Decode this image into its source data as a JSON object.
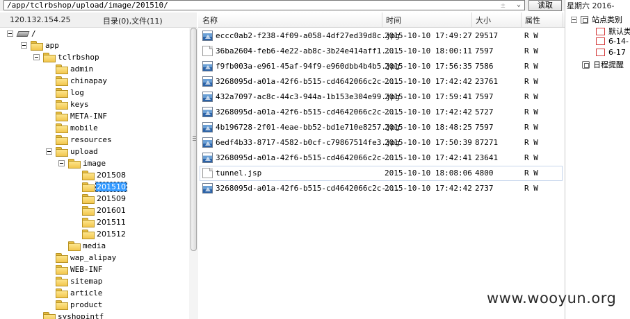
{
  "path_bar": {
    "path": "/app/tclrbshop/upload/image/201510/",
    "extra_glyph": "±",
    "dropdown_glyph": "⌄",
    "read_button": "读取"
  },
  "left_header": {
    "ip": "120.132.154.25",
    "counts": "目录(0),文件(11)"
  },
  "tree": [
    {
      "label": "/",
      "icon": "drive",
      "depth": 0,
      "expanded": true
    },
    {
      "label": "app",
      "icon": "folder",
      "depth": 1,
      "expanded": true
    },
    {
      "label": "tclrbshop",
      "icon": "folder",
      "depth": 2,
      "expanded": true
    },
    {
      "label": "admin",
      "icon": "folder",
      "depth": 3
    },
    {
      "label": "chinapay",
      "icon": "folder",
      "depth": 3
    },
    {
      "label": "log",
      "icon": "folder",
      "depth": 3
    },
    {
      "label": "keys",
      "icon": "folder",
      "depth": 3
    },
    {
      "label": "META-INF",
      "icon": "folder",
      "depth": 3
    },
    {
      "label": "mobile",
      "icon": "folder",
      "depth": 3
    },
    {
      "label": "resources",
      "icon": "folder",
      "depth": 3
    },
    {
      "label": "upload",
      "icon": "folder",
      "depth": 3,
      "expanded": true
    },
    {
      "label": "image",
      "icon": "folder",
      "depth": 4,
      "expanded": true
    },
    {
      "label": "201508",
      "icon": "folder",
      "depth": 5,
      "font": "sans"
    },
    {
      "label": "201510",
      "icon": "folder",
      "depth": 5,
      "selected": true,
      "font": "sans"
    },
    {
      "label": "201509",
      "icon": "folder",
      "depth": 5,
      "font": "sans"
    },
    {
      "label": "201601",
      "icon": "folder",
      "depth": 5,
      "font": "sans"
    },
    {
      "label": "201511",
      "icon": "folder",
      "depth": 5,
      "font": "sans"
    },
    {
      "label": "201512",
      "icon": "folder",
      "depth": 5,
      "font": "sans"
    },
    {
      "label": "media",
      "icon": "folder",
      "depth": 4
    },
    {
      "label": "wap_alipay",
      "icon": "folder",
      "depth": 3
    },
    {
      "label": "WEB-INF",
      "icon": "folder",
      "depth": 3
    },
    {
      "label": "sitemap",
      "icon": "folder",
      "depth": 3
    },
    {
      "label": "article",
      "icon": "folder",
      "depth": 3
    },
    {
      "label": "product",
      "icon": "folder",
      "depth": 3
    },
    {
      "label": "syshopintf",
      "icon": "folder",
      "depth": 2
    }
  ],
  "list_columns": {
    "name": "名称",
    "time": "时间",
    "size": "大小",
    "attr": "属性"
  },
  "files": [
    {
      "name": "eccc0ab2-f238-4f09-a058-4df27ed39d8c.jpg",
      "time": "2015-10-10 17:49:27",
      "size": "29517",
      "attr": "R W",
      "icon": "image"
    },
    {
      "name": "36ba2604-feb6-4e22-ab8c-3b24e414aff1....",
      "time": "2015-10-10 18:00:11",
      "size": "7597",
      "attr": "R W",
      "icon": "document"
    },
    {
      "name": "f9fb003a-e961-45af-94f9-e960dbb4b4b5.jpg",
      "time": "2015-10-10 17:56:35",
      "size": "7586",
      "attr": "R W",
      "icon": "image"
    },
    {
      "name": "3268095d-a01a-42f6-b515-cd4642066c2c-...",
      "time": "2015-10-10 17:42:42",
      "size": "23761",
      "attr": "R W",
      "icon": "image"
    },
    {
      "name": "432a7097-ac8c-44c3-944a-1b153e304e99.jpg",
      "time": "2015-10-10 17:59:41",
      "size": "7597",
      "attr": "R W",
      "icon": "image"
    },
    {
      "name": "3268095d-a01a-42f6-b515-cd4642066c2c-...",
      "time": "2015-10-10 17:42:42",
      "size": "5727",
      "attr": "R W",
      "icon": "image"
    },
    {
      "name": "4b196728-2f01-4eae-bb52-bd1e710e8257.jpg",
      "time": "2015-10-10 18:48:25",
      "size": "7597",
      "attr": "R W",
      "icon": "image"
    },
    {
      "name": "6edf4b33-8717-4582-b0cf-c79867514fe3.jpg",
      "time": "2015-10-10 17:50:39",
      "size": "87271",
      "attr": "R W",
      "icon": "image"
    },
    {
      "name": "3268095d-a01a-42f6-b515-cd4642066c2c-...",
      "time": "2015-10-10 17:42:41",
      "size": "23641",
      "attr": "R W",
      "icon": "image"
    },
    {
      "name": "tunnel.jsp",
      "time": "2015-10-10 18:08:06",
      "size": "4800",
      "attr": "R W",
      "icon": "document",
      "focused": true
    },
    {
      "name": "3268095d-a01a-42f6-b515-cd4642066c2c-...",
      "time": "2015-10-10 17:42:42",
      "size": "2737",
      "attr": "R W",
      "icon": "image"
    }
  ],
  "right_panel": {
    "header": "星期六 2016-",
    "site_category": "站点类别",
    "items": [
      "默认类",
      "6-14-",
      "6-17"
    ],
    "schedule": "日程提醒"
  },
  "watermark": "www.wooyun.org"
}
